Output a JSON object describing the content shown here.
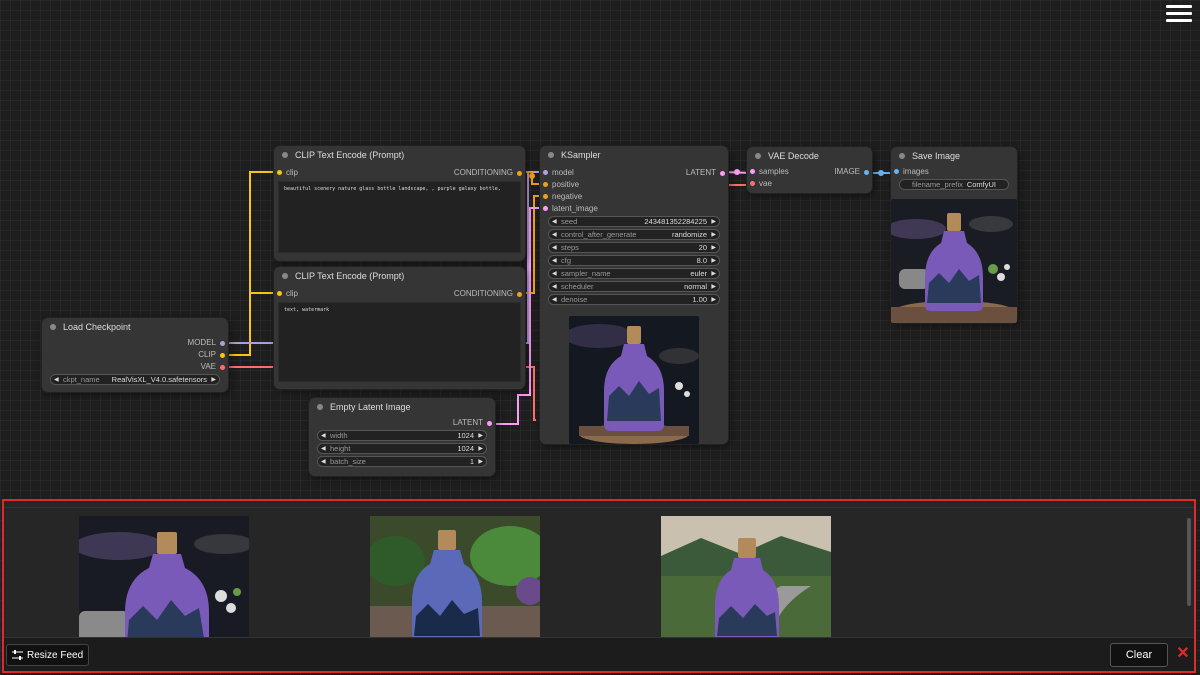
{
  "menu": {
    "icon": "hamburger-menu-icon"
  },
  "nodes": {
    "clip_text_1": {
      "title": "CLIP Text Encode (Prompt)",
      "input": "clip",
      "output": "CONDITIONING",
      "text": "beautiful scenery nature glass bottle landscape, , purple galaxy bottle,"
    },
    "clip_text_2": {
      "title": "CLIP Text Encode (Prompt)",
      "input": "clip",
      "output": "CONDITIONING",
      "text": "text, watermark"
    },
    "ksampler": {
      "title": "KSampler",
      "inputs": [
        "model",
        "positive",
        "negative",
        "latent_image"
      ],
      "output": "LATENT",
      "widgets": [
        {
          "name": "seed",
          "value": "243481352284225"
        },
        {
          "name": "control_after_generate",
          "value": "randomize"
        },
        {
          "name": "steps",
          "value": "20"
        },
        {
          "name": "cfg",
          "value": "8.0"
        },
        {
          "name": "sampler_name",
          "value": "euler"
        },
        {
          "name": "scheduler",
          "value": "normal"
        },
        {
          "name": "denoise",
          "value": "1.00"
        }
      ]
    },
    "vae_decode": {
      "title": "VAE Decode",
      "inputs": [
        "samples",
        "vae"
      ],
      "output": "IMAGE"
    },
    "save_image": {
      "title": "Save Image",
      "input": "images",
      "widget": {
        "name": "filename_prefix",
        "value": "ComfyUI"
      }
    },
    "load_checkpoint": {
      "title": "Load Checkpoint",
      "outputs": [
        "MODEL",
        "CLIP",
        "VAE"
      ],
      "widget": {
        "name": "ckpt_name",
        "value": "RealVisXL_V4.0.safetensors"
      }
    },
    "empty_latent": {
      "title": "Empty Latent Image",
      "output": "LATENT",
      "widgets": [
        {
          "name": "width",
          "value": "1024"
        },
        {
          "name": "height",
          "value": "1024"
        },
        {
          "name": "batch_size",
          "value": "1"
        }
      ]
    }
  },
  "feed": {
    "resize_label": "Resize Feed",
    "clear_label": "Clear",
    "close_symbol": "✕",
    "image_count": 3
  },
  "colors": {
    "clip": "#f5c518",
    "conditioning": "#f0a020",
    "model": "#b39ddb",
    "vae": "#ff6e6e",
    "latent": "#ff9cf9",
    "image": "#64b5f6",
    "highlight": "#e02a2a"
  }
}
